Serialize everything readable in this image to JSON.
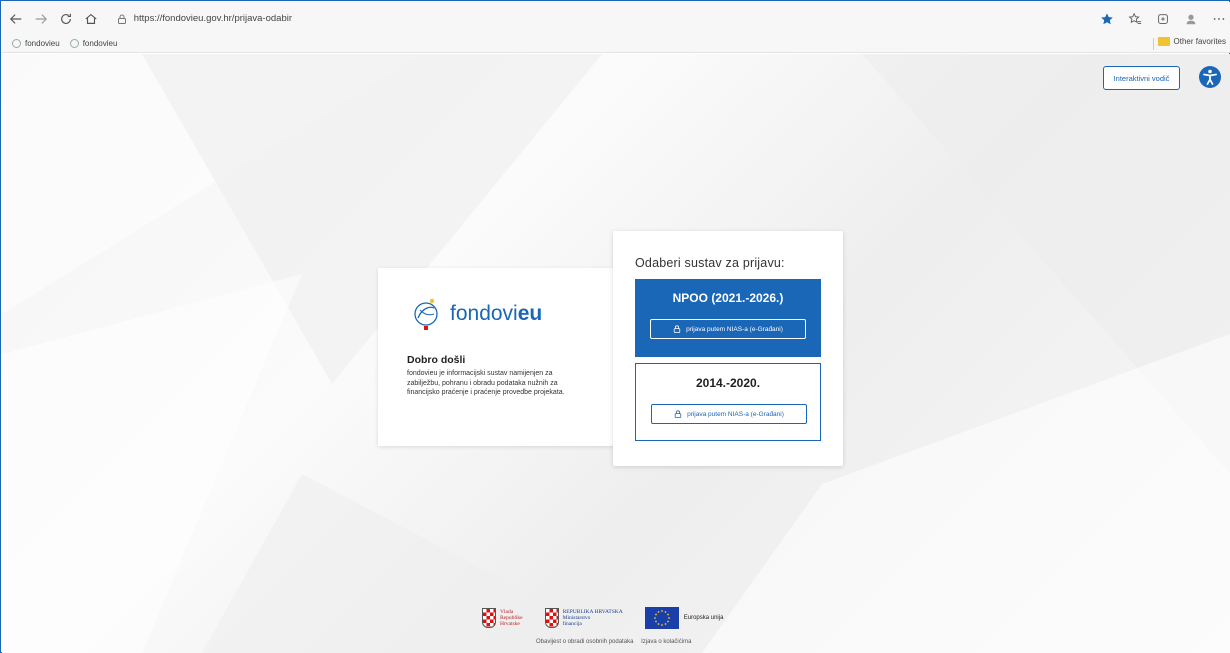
{
  "browser": {
    "url": "https://fondovieu.gov.hr/prijava-odabir",
    "bookmarks": [
      "fondovieu",
      "fondovieu"
    ],
    "other_favorites": "Other favorites"
  },
  "header": {
    "guide_button": "Interaktivni vodič"
  },
  "welcome": {
    "logo_prefix": "fondovi",
    "logo_suffix": "eu",
    "title": "Dobro došli",
    "body": "fondovieu je informacijski sustav namijenjen za zabilježbu, pohranu i obradu podataka nužnih za financijsko praćenje i praćenje provedbe projekata."
  },
  "login": {
    "title": "Odaberi sustav za prijavu:",
    "systems": [
      {
        "title": "NPOO (2021.-2026.)",
        "button": "prijava putem NIAS-a (e-Građani)"
      },
      {
        "title": "2014.-2020.",
        "button": "prijava putem NIAS-a (e-Građani)"
      }
    ]
  },
  "footer": {
    "logo1": [
      "Vlada",
      "Republike",
      "Hrvatske"
    ],
    "logo2": [
      "REPUBLIKA HRVATSKA",
      "Ministarstvo",
      "financija"
    ],
    "eu": "Europska unija",
    "links": [
      "Obavijest o obradi osobnih podataka",
      "Izjava o kolačićima"
    ]
  },
  "colors": {
    "accent": "#1a66b7",
    "favorite_star": "#1a66b7"
  }
}
